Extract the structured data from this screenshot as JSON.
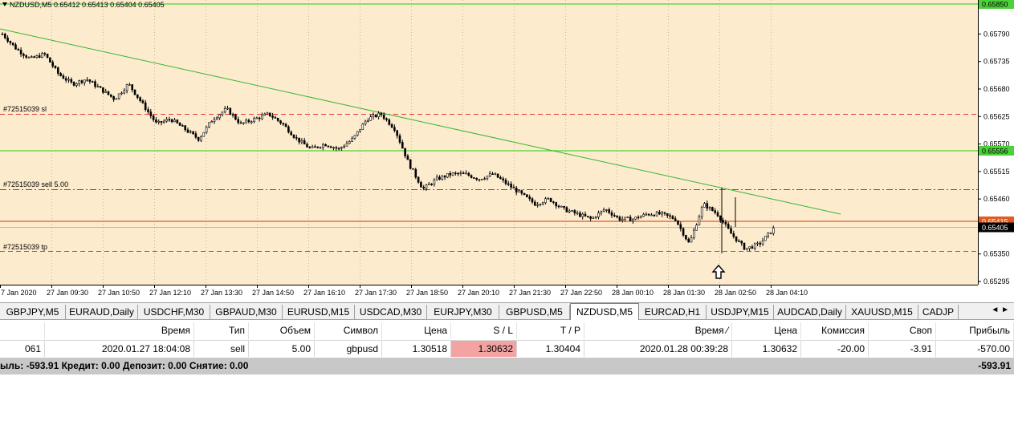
{
  "chart": {
    "header": "NZDUSD,M5  0.65412 0.65413 0.65404 0.65405",
    "background": "#fdebcd",
    "price_levels": [
      "0.65790",
      "0.65735",
      "0.65680",
      "0.65625",
      "0.65570",
      "0.65515",
      "0.65460",
      "0.65350",
      "0.65295"
    ],
    "highlight_labels": {
      "top": "0.65850",
      "green_mid": "0.65556",
      "red": "0.65415",
      "current": "0.65405"
    },
    "line_labels": {
      "sl": "#72515039 sl",
      "sell": "#72515039 sell 5.00",
      "tp": "#72515039 tp"
    },
    "time_labels": [
      "7 Jan 2020",
      "27 Jan 09:30",
      "27 Jan 10:50",
      "27 Jan 12:10",
      "27 Jan 13:30",
      "27 Jan 14:50",
      "27 Jan 16:10",
      "27 Jan 17:30",
      "27 Jan 18:50",
      "27 Jan 20:10",
      "27 Jan 21:30",
      "27 Jan 22:50",
      "28 Jan 00:10",
      "28 Jan 01:30",
      "28 Jan 02:50",
      "28 Jan 04:10"
    ],
    "colors": {
      "green": "#4cd13a",
      "trend": "#33b633",
      "red": "#e15a1e",
      "dash_red": "#e23b3b",
      "dash_green": "#1b8a1b",
      "candle": "#000000"
    }
  },
  "chart_data": {
    "type": "candlestick",
    "symbol": "NZDUSD",
    "timeframe": "M5",
    "ylim": [
      0.65295,
      0.6585
    ],
    "close_path": [
      0.6579,
      0.6576,
      0.6574,
      0.6575,
      0.6571,
      0.6569,
      0.657,
      0.6568,
      0.6566,
      0.6569,
      0.6565,
      0.6561,
      0.6562,
      0.656,
      0.6558,
      0.6562,
      0.6564,
      0.6561,
      0.6562,
      0.6563,
      0.6561,
      0.6558,
      0.6556,
      0.6557,
      0.6556,
      0.6558,
      0.6562,
      0.6563,
      0.656,
      0.6553,
      0.6548,
      0.655,
      0.6551,
      0.6551,
      0.655,
      0.6551,
      0.6549,
      0.6547,
      0.6545,
      0.6546,
      0.6544,
      0.6543,
      0.6542,
      0.6544,
      0.6542,
      0.6542,
      0.6543,
      0.6543,
      0.6542,
      0.6537,
      0.6545,
      0.6543,
      0.6539,
      0.6536,
      0.6537,
      0.654
    ]
  },
  "tabs": [
    "GBPJPY,M5",
    "EURAUD,Daily",
    "USDCHF,M30",
    "GBPAUD,M30",
    "EURUSD,M15",
    "USDCAD,M30",
    "EURJPY,M30",
    "GBPUSD,M5",
    "NZDUSD,M5",
    "EURCAD,H1",
    "USDJPY,M15",
    "AUDCAD,Daily",
    "XAUUSD,M15",
    "CADJP"
  ],
  "active_tab": "NZDUSD,M5",
  "tab_arrows": "◄ ►",
  "table": {
    "headers": [
      "",
      "Время",
      "Тип",
      "Объем",
      "Символ",
      "Цена",
      "S / L",
      "T / P",
      "Время  ⁄",
      "Цена",
      "Комиссия",
      "Своп",
      "Прибыль"
    ],
    "row": [
      "061",
      "2020.01.27 18:04:08",
      "sell",
      "5.00",
      "gbpusd",
      "1.30518",
      "1.30632",
      "1.30404",
      "2020.01.28 00:39:28",
      "1.30632",
      "-20.00",
      "-3.91",
      "-570.00"
    ],
    "summary_left": "ыль: -593.91  Кредит: 0.00  Депозит: 0.00  Снятие: 0.00",
    "summary_right": "-593.91"
  }
}
